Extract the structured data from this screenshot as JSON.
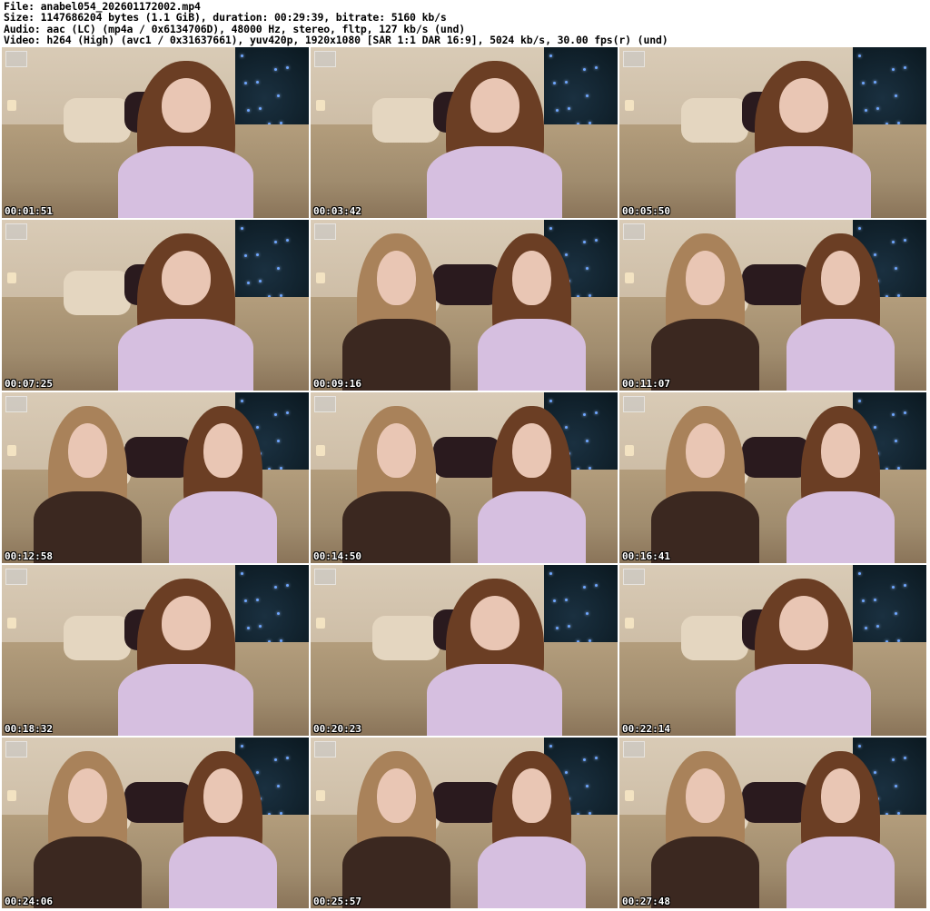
{
  "header": {
    "file": "File: anabel054_202601172002.mp4",
    "size": "Size: 1147686204 bytes (1.1 GiB), duration: 00:29:39, bitrate: 5160 kb/s",
    "audio": "Audio: aac (LC) (mp4a / 0x6134706D), 48000 Hz, stereo, fltp, 127 kb/s (und)",
    "video": "Video: h264 (High) (avc1 / 0x31637661), yuv420p, 1920x1080 [SAR 1:1 DAR 16:9], 5024 kb/s, 30.00 fps(r) (und)"
  },
  "thumbnails": [
    {
      "timestamp": "00:01:51"
    },
    {
      "timestamp": "00:03:42"
    },
    {
      "timestamp": "00:05:50"
    },
    {
      "timestamp": "00:07:25"
    },
    {
      "timestamp": "00:09:16"
    },
    {
      "timestamp": "00:11:07"
    },
    {
      "timestamp": "00:12:58"
    },
    {
      "timestamp": "00:14:50"
    },
    {
      "timestamp": "00:16:41"
    },
    {
      "timestamp": "00:18:32"
    },
    {
      "timestamp": "00:20:23"
    },
    {
      "timestamp": "00:22:14"
    },
    {
      "timestamp": "00:24:06"
    },
    {
      "timestamp": "00:25:57"
    },
    {
      "timestamp": "00:27:48"
    }
  ],
  "colors": {
    "wall": "#cdbda6",
    "bed": "#a08c6e",
    "lavender_top": "#d6bfe0",
    "brown_top": "#3b2820",
    "hair_brown": "#6b3e24",
    "hair_blonde": "#a9825a"
  }
}
